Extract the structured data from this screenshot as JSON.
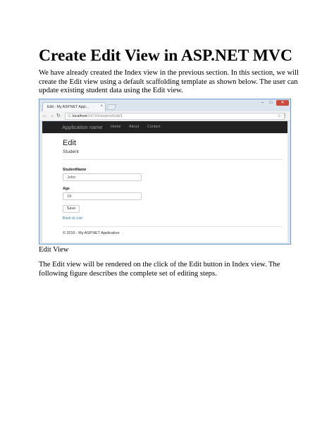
{
  "document": {
    "title": "Create Edit View in ASP.NET MVC",
    "intro": "We have already created the Index view in the previous section. In this section, we will create the Edit view using a default scaffolding template as shown below. The user can update existing student data using the Edit view.",
    "caption": "Edit View",
    "paragraph2": "The Edit view will be rendered on the click of the Edit button in Index view. The following figure describes the complete set of editing steps."
  },
  "browser": {
    "tab_title": "Edit - My ASP.NET Appl...",
    "url_host": "localhost",
    "url_path": ":54710/student/Edit/1",
    "window_controls": {
      "minimize": "–",
      "maximize": "□",
      "close": "✕"
    }
  },
  "app": {
    "brand": "Application name",
    "nav": [
      "Home",
      "About",
      "Contact"
    ],
    "heading": "Edit",
    "subheading": "Student",
    "fields": [
      {
        "label": "StudentName",
        "value": "John"
      },
      {
        "label": "Age",
        "value": "18"
      }
    ],
    "save_label": "Save",
    "back_label": "Back to List",
    "footer": "© 2016 - My ASP.NET Application"
  },
  "colors": {
    "navbar": "#222222",
    "link": "#337ab7",
    "window_border": "#6b9bd1",
    "close_button": "#c94a3e"
  },
  "icons": [
    "back-arrow-icon",
    "forward-arrow-icon",
    "reload-icon",
    "info-icon",
    "star-icon",
    "menu-dots-icon",
    "tab-close-icon"
  ]
}
